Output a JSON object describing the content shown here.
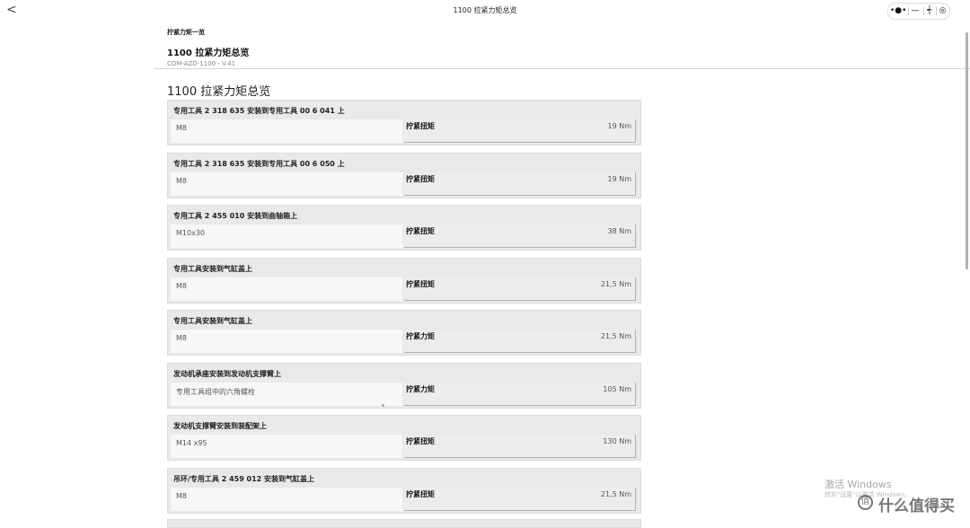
{
  "window": {
    "title": "1100 拉紧力矩总览",
    "back_glyph": "<",
    "capsule": {
      "more_glyph": "•●•",
      "minimize_glyph": "—",
      "scan_glyph": "┽",
      "close_glyph": "◎"
    }
  },
  "header": {
    "breadcrumb": "拧紧力矩一览",
    "title": "1100 拉紧力矩总览",
    "code": "COM-AZD-1100 - V.41"
  },
  "section": {
    "title": "1100 拉紧力矩总览"
  },
  "cards": [
    {
      "head": "专用工具 2 318 635 安装到专用工具 00 6 041 上",
      "spec": "M8",
      "label": "拧紧扭矩",
      "value": "19 Nm"
    },
    {
      "head": "专用工具 2 318 635 安装到专用工具 00 6 050 上",
      "spec": "M8",
      "label": "拧紧扭矩",
      "value": "19 Nm"
    },
    {
      "head": "专用工具 2 455 010 安装到曲轴箱上",
      "spec": "M10x30",
      "label": "拧紧扭矩",
      "value": "38 Nm"
    },
    {
      "head": "专用工具安装到气缸盖上",
      "spec": "M8",
      "label": "拧紧扭矩",
      "value": "21,5 Nm"
    },
    {
      "head": "专用工具安装到气缸盖上",
      "spec": "M8",
      "label": "拧紧力矩",
      "value": "21,5 Nm"
    },
    {
      "head": "发动机承座安装到发动机支撑臂上",
      "spec": "专用工具组中的六角螺栓",
      "label": "拧紧力矩",
      "value": "105 Nm"
    },
    {
      "head": "发动机支撑臂安装到装配架上",
      "spec": "M14 x95",
      "label": "拧紧扭矩",
      "value": "130 Nm"
    },
    {
      "head": "吊环/专用工具 2 459 012 安装到气缸盖上",
      "spec": "M8",
      "label": "拧紧扭矩",
      "value": "21,5 Nm"
    }
  ],
  "watermark": {
    "title": "激活 Windows",
    "subtitle": "转到\"设置\"以激活 Windows。",
    "brand": "什么值得买",
    "brand_icon": "值"
  }
}
